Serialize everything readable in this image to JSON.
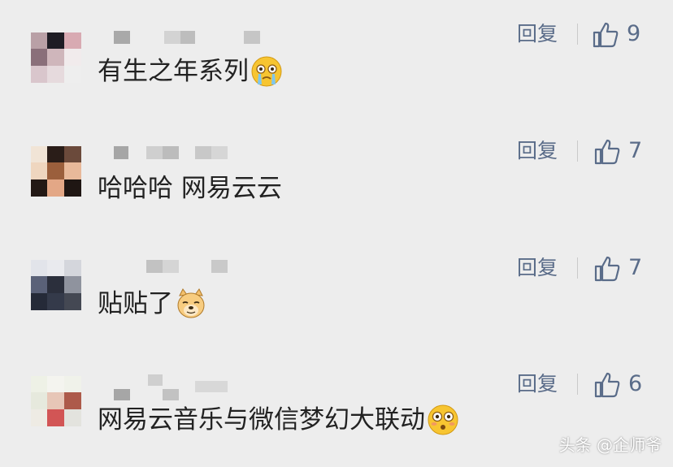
{
  "comments": [
    {
      "text": "有生之年系列",
      "emoji": "crying-face-emoji",
      "reply_label": "回复",
      "likes": "9"
    },
    {
      "text": "哈哈哈 网易云云",
      "emoji": "",
      "reply_label": "回复",
      "likes": "7"
    },
    {
      "text": "贴贴了",
      "emoji": "doge-emoji",
      "reply_label": "回复",
      "likes": "7"
    },
    {
      "text": "网易云音乐与微信梦幻大联动",
      "emoji": "flushed-face-emoji",
      "reply_label": "回复",
      "likes": "6"
    }
  ],
  "watermark": "头条 @企师爷",
  "colors": {
    "background": "#ededed",
    "link": "#5a6c89",
    "text": "#222222"
  }
}
